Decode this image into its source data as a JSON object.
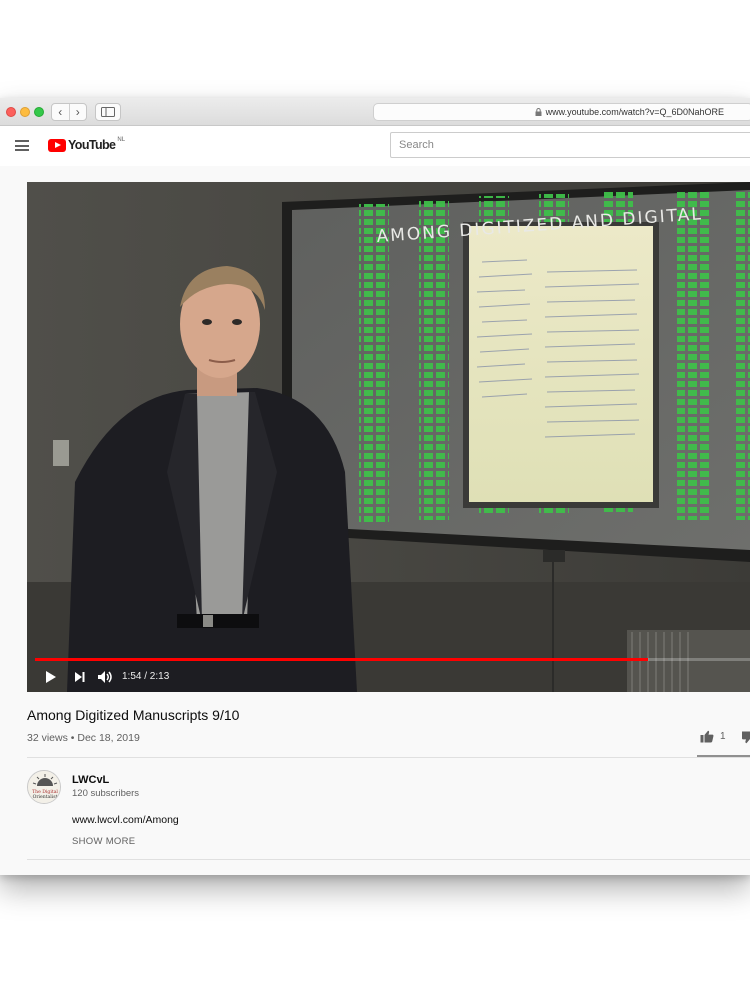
{
  "browser": {
    "url": "www.youtube.com/watch?v=Q_6D0NahORE",
    "back_glyph": "‹",
    "forward_glyph": "›",
    "lock_icon": "lock-icon"
  },
  "header": {
    "logo_text": "YouTube",
    "country_code": "NL",
    "search_placeholder": "Search"
  },
  "player": {
    "current_time": "1:54",
    "duration": "2:13",
    "time_display": "1:54 / 2:13",
    "progress_fraction": 0.857,
    "slide_title": "AMONG DIGITIZED AND DIGITAL"
  },
  "video": {
    "title": "Among Digitized Manuscripts 9/10",
    "meta": "32 views • Dec 18, 2019",
    "like_count": "1"
  },
  "channel": {
    "name": "LWCvL",
    "subscribers": "120 subscribers",
    "avatar_text_1": "The Digital",
    "avatar_text_2": "Orientalist",
    "description": "www.lwcvl.com/Among",
    "show_more": "SHOW MORE"
  },
  "colors": {
    "brand_red": "#ff0000",
    "progress_red": "#ff0000",
    "slide_green": "#3fbf4a"
  }
}
